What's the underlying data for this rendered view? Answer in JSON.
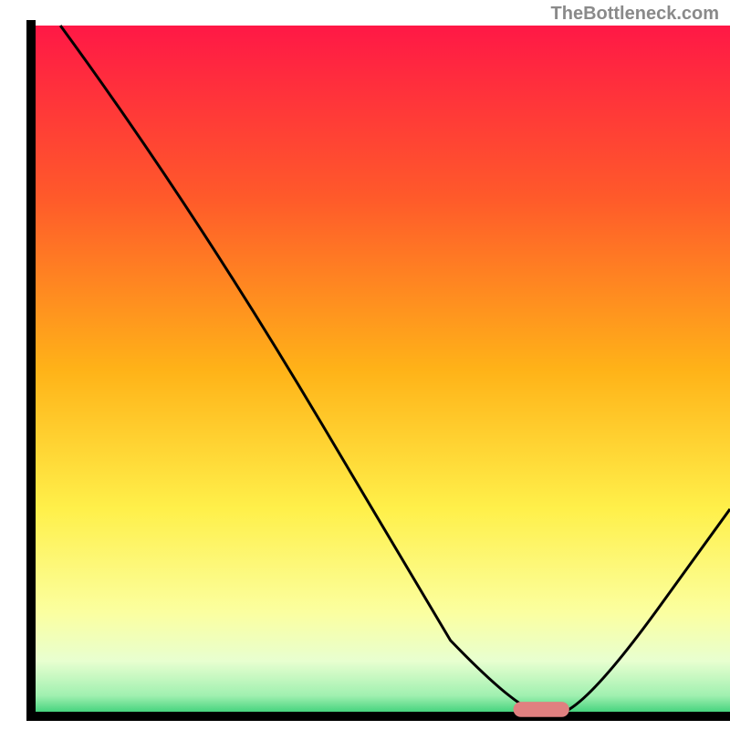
{
  "watermark": "TheBottleneck.com",
  "chart_data": {
    "type": "line",
    "title": "",
    "xlabel": "",
    "ylabel": "",
    "xlim": [
      0,
      100
    ],
    "ylim": [
      0,
      100
    ],
    "grid": false,
    "annotations": [],
    "gradient_background": {
      "description": "vertical gradient red to green representing bottleneck scale",
      "stops": [
        {
          "offset": 0.0,
          "color": "#ff1846"
        },
        {
          "offset": 0.25,
          "color": "#ff5a2a"
        },
        {
          "offset": 0.5,
          "color": "#ffb318"
        },
        {
          "offset": 0.7,
          "color": "#fff04a"
        },
        {
          "offset": 0.85,
          "color": "#fbffa0"
        },
        {
          "offset": 0.92,
          "color": "#e8ffd0"
        },
        {
          "offset": 0.97,
          "color": "#a0f0b0"
        },
        {
          "offset": 1.0,
          "color": "#2ecc71"
        }
      ]
    },
    "axes_frame": {
      "description": "black L-shaped axes on left and bottom",
      "x_from": 4,
      "x_to": 100,
      "y_from": 0,
      "y_to": 98
    },
    "series": [
      {
        "name": "bottleneck-curve",
        "color": "#000000",
        "stroke_width": 3,
        "x": [
          4.2,
          23,
          60,
          70,
          76,
          80,
          100
        ],
        "values": [
          100,
          74,
          11,
          0.5,
          0.5,
          2,
          30
        ]
      }
    ],
    "marker": {
      "name": "optimal-range",
      "shape": "rounded-rect",
      "color": "#e08080",
      "x_center": 73,
      "y_center": 1,
      "width": 8,
      "height": 2.2,
      "rx": 1
    }
  }
}
